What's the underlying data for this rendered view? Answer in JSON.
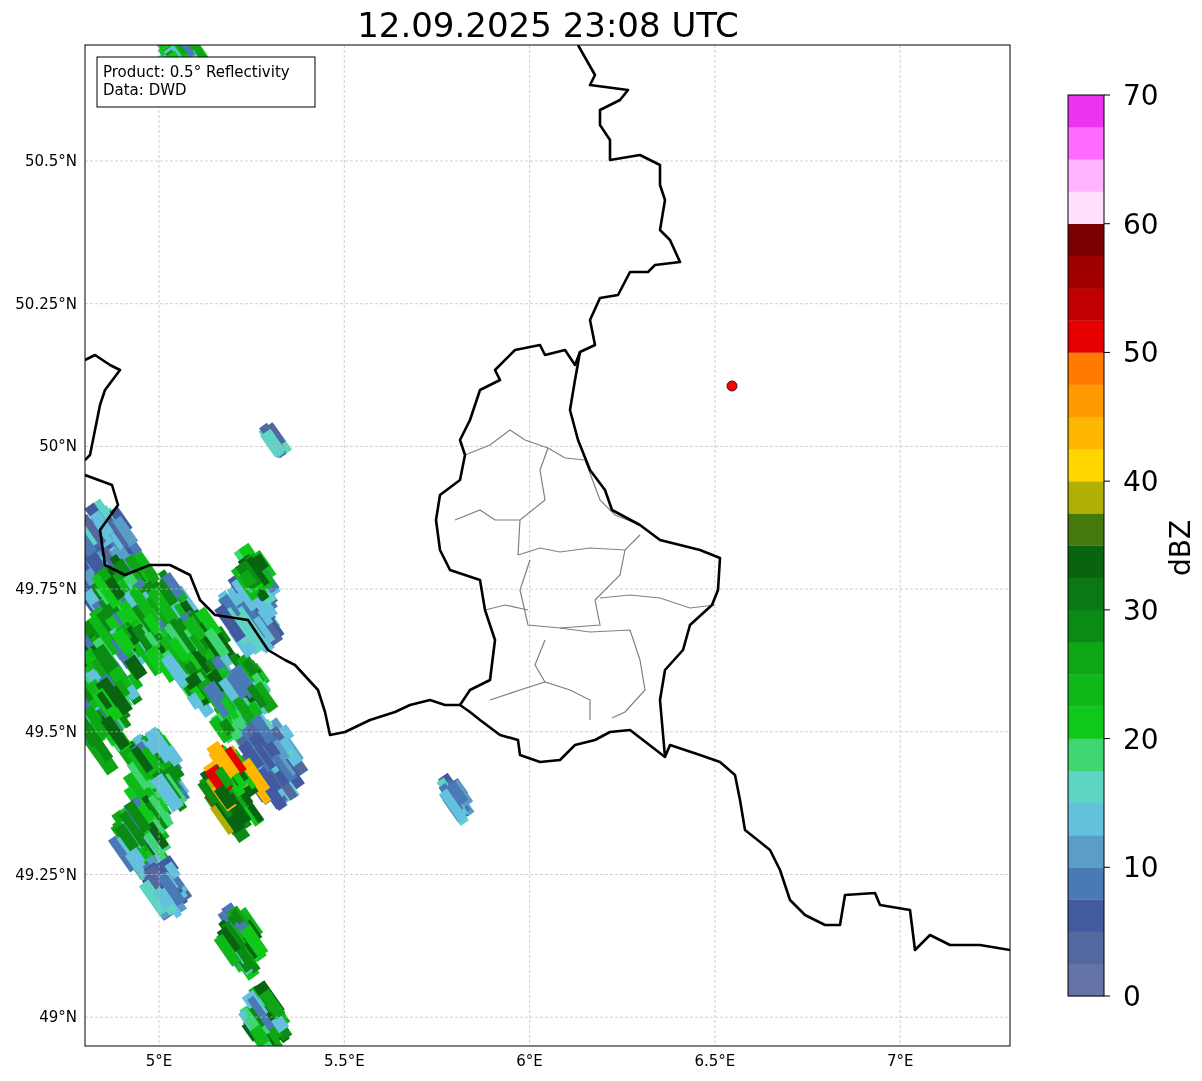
{
  "title": "12.09.2025 23:08 UTC",
  "legend": {
    "lines": [
      "Product: 0.5° Reflectivity",
      "Data: DWD"
    ]
  },
  "map": {
    "x_ticks": [
      "5°E",
      "5.5°E",
      "6°E",
      "6.5°E",
      "7°E"
    ],
    "y_ticks": [
      "50.5°N",
      "50.25°N",
      "50°N",
      "49.75°N",
      "49.5°N",
      "49.25°N",
      "49°N"
    ]
  },
  "colorbar": {
    "label": "dBZ",
    "ticks": [
      "70",
      "60",
      "50",
      "40",
      "30",
      "20",
      "10",
      "0"
    ],
    "segments": [
      {
        "color": "#6574a8"
      },
      {
        "color": "#53689f"
      },
      {
        "color": "#425ba0"
      },
      {
        "color": "#4a7ab5"
      },
      {
        "color": "#5a9ec8"
      },
      {
        "color": "#64c1dd"
      },
      {
        "color": "#5ed5c4"
      },
      {
        "color": "#3dd671"
      },
      {
        "color": "#10c81a"
      },
      {
        "color": "#0eb818"
      },
      {
        "color": "#0ea614"
      },
      {
        "color": "#0b8b13"
      },
      {
        "color": "#0a7814"
      },
      {
        "color": "#086410"
      },
      {
        "color": "#45790c"
      },
      {
        "color": "#b0b004"
      },
      {
        "color": "#ffd600"
      },
      {
        "color": "#ffb600"
      },
      {
        "color": "#ff9a00"
      },
      {
        "color": "#ff7b00"
      },
      {
        "color": "#e60000"
      },
      {
        "color": "#c00000"
      },
      {
        "color": "#a00000"
      },
      {
        "color": "#780000"
      },
      {
        "color": "#ffe0ff"
      },
      {
        "color": "#ffb4ff"
      },
      {
        "color": "#ff6cff"
      },
      {
        "color": "#eb34ef"
      }
    ]
  }
}
